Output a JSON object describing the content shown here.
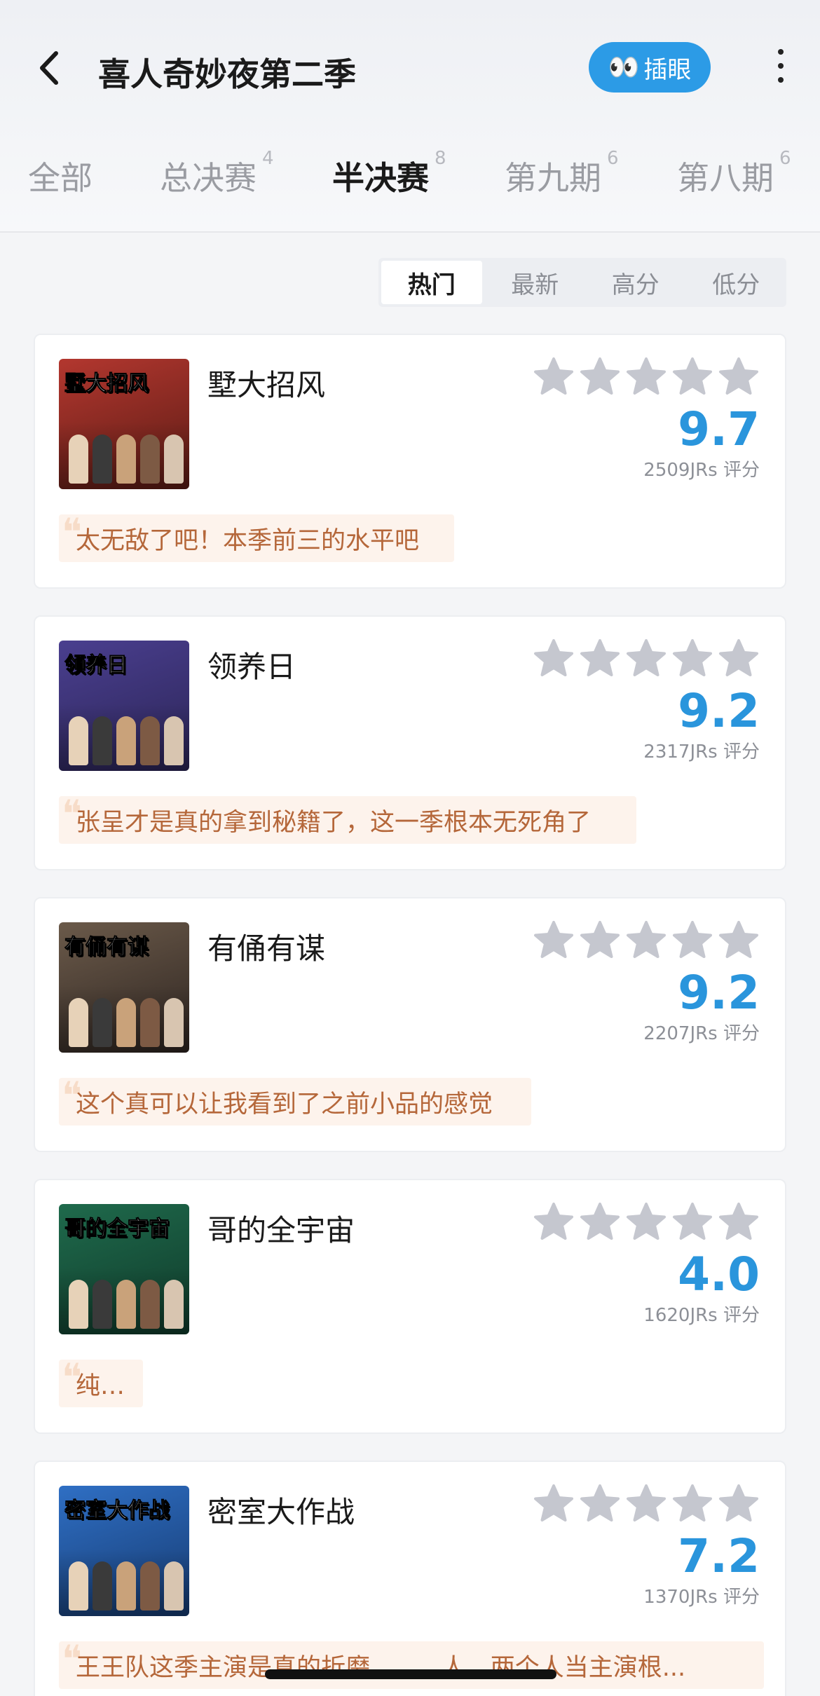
{
  "header": {
    "title": "喜人奇妙夜第二季",
    "peek_button": {
      "icon": "eyes-emoji",
      "label": "插眼"
    },
    "colors": {
      "accent": "#2c9be6"
    }
  },
  "tabs": [
    {
      "label": "全部",
      "count": ""
    },
    {
      "label": "总决赛",
      "count": "4"
    },
    {
      "label": "半决赛",
      "count": "8"
    },
    {
      "label": "第九期",
      "count": "6"
    },
    {
      "label": "第八期",
      "count": "6"
    }
  ],
  "active_tab": "半决赛",
  "sort": {
    "options": [
      "热门",
      "最新",
      "高分",
      "低分"
    ],
    "active": "热门"
  },
  "items": [
    {
      "name": "墅大招风",
      "poster_title": "墅大招风",
      "score": "9.7",
      "ratings": "2509JRs 评分",
      "comment": "太无敌了吧！本季前三的水平吧",
      "poster_colors": [
        "#b3372f",
        "#5a1b14"
      ]
    },
    {
      "name": "领养日",
      "poster_title": "领养日",
      "score": "9.2",
      "ratings": "2317JRs 评分",
      "comment": "张呈才是真的拿到秘籍了，这一季根本无死角了",
      "poster_colors": [
        "#4a3f8f",
        "#2b2456"
      ]
    },
    {
      "name": "有俑有谋",
      "poster_title": "有俑有谋",
      "score": "9.2",
      "ratings": "2207JRs 评分",
      "comment": "这个真可以让我看到了之前小品的感觉",
      "poster_colors": [
        "#6b5a4a",
        "#2d2420"
      ]
    },
    {
      "name": "哥的全宇宙",
      "poster_title": "哥的全宇宙",
      "score": "4.0",
      "ratings": "1620JRs 评分",
      "comment": "纯尬",
      "poster_colors": [
        "#1f6a4c",
        "#0f3a2a"
      ]
    },
    {
      "name": "密室大作战",
      "poster_title": "密室大作战",
      "score": "7.2",
      "ratings": "1370JRs 评分",
      "comment": "王王队这季主演是真的折磨，......人，两个人当主演根...",
      "poster_colors": [
        "#2f6fc4",
        "#163a70"
      ]
    }
  ],
  "star_color": "#c5c7cf",
  "rating_color": "#2a95dc",
  "comment_color": "#b5673a"
}
